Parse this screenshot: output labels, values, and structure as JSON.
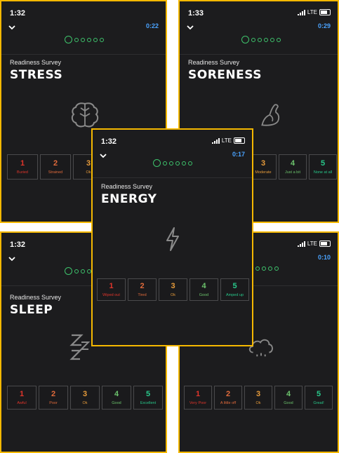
{
  "colors": {
    "frame": "#f5b800",
    "timer": "#4aa3ff",
    "progress": "#3ec36c"
  },
  "screens": {
    "stress": {
      "time": "1:32",
      "timer": "0:22",
      "subtitle": "Readiness Survey",
      "title": "STRESS",
      "icon": "brain-icon",
      "options": [
        {
          "n": "1",
          "l": "Buried"
        },
        {
          "n": "2",
          "l": "Strained"
        },
        {
          "n": "3",
          "l": "Ok"
        }
      ]
    },
    "soreness": {
      "time": "1:33",
      "network": "LTE",
      "timer": "0:29",
      "subtitle": "Readiness Survey",
      "title": "SORENESS",
      "icon": "flexed-arm-icon",
      "options": [
        {
          "n": "3",
          "l": "Moderate"
        },
        {
          "n": "4",
          "l": "Just a bit"
        },
        {
          "n": "5",
          "l": "None at all"
        }
      ]
    },
    "energy": {
      "time": "1:32",
      "network": "LTE",
      "timer": "0:17",
      "subtitle": "Readiness Survey",
      "title": "ENERGY",
      "icon": "lightning-bolt-icon",
      "options": [
        {
          "n": "1",
          "l": "Wiped out"
        },
        {
          "n": "2",
          "l": "Tired"
        },
        {
          "n": "3",
          "l": "Ok"
        },
        {
          "n": "4",
          "l": "Good"
        },
        {
          "n": "5",
          "l": "Amped up"
        }
      ]
    },
    "sleep": {
      "time": "1:32",
      "subtitle": "Readiness Survey",
      "title": "SLEEP",
      "icon": "sleep-zzz-icon",
      "options": [
        {
          "n": "1",
          "l": "Awful"
        },
        {
          "n": "2",
          "l": "Poor"
        },
        {
          "n": "3",
          "l": "Ok"
        },
        {
          "n": "4",
          "l": "Good"
        },
        {
          "n": "5",
          "l": "Excellent"
        }
      ]
    },
    "mood": {
      "network": "LTE",
      "timer": "0:10",
      "icon": "rain-cloud-icon",
      "options": [
        {
          "n": "1",
          "l": "Very Poor"
        },
        {
          "n": "2",
          "l": "A little off"
        },
        {
          "n": "3",
          "l": "Ok"
        },
        {
          "n": "4",
          "l": "Good"
        },
        {
          "n": "5",
          "l": "Great!"
        }
      ]
    }
  }
}
